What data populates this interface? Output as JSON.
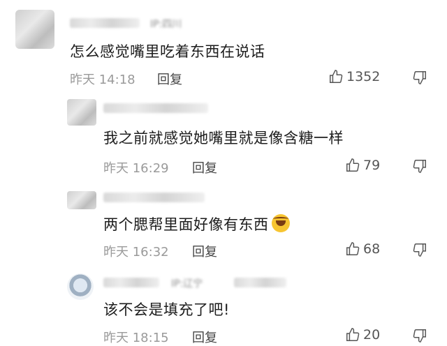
{
  "comments": [
    {
      "content": "怎么感觉嘴里吃着东西在说话",
      "time": "昨天 14:18",
      "reply_label": "回复",
      "likes": "1352",
      "username_hint": "IP:四川"
    },
    {
      "content": "我之前就感觉她嘴里就是像含糖一样",
      "time": "昨天 16:29",
      "reply_label": "回复",
      "likes": "79"
    },
    {
      "content": "两个腮帮里面好像有东西",
      "time": "昨天 16:32",
      "reply_label": "回复",
      "likes": "68",
      "emoji": "laugh-cry-emoji"
    },
    {
      "content": "该不会是填充了吧!",
      "time": "昨天 18:15",
      "reply_label": "回复",
      "likes": "20",
      "username_hint": "IP:辽宁"
    }
  ],
  "icons": {
    "like": "thumbs-up-icon",
    "dislike": "thumbs-down-icon"
  }
}
